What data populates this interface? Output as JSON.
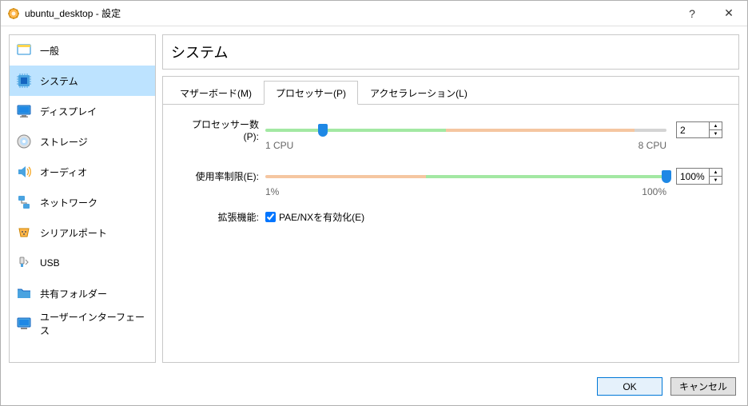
{
  "window": {
    "title": "ubuntu_desktop - 設定"
  },
  "sidebar": {
    "items": [
      {
        "label": "一般"
      },
      {
        "label": "システム"
      },
      {
        "label": "ディスプレイ"
      },
      {
        "label": "ストレージ"
      },
      {
        "label": "オーディオ"
      },
      {
        "label": "ネットワーク"
      },
      {
        "label": "シリアルポート"
      },
      {
        "label": "USB"
      },
      {
        "label": "共有フォルダー"
      },
      {
        "label": "ユーザーインターフェース"
      }
    ],
    "active_index": 1
  },
  "main": {
    "heading": "システム",
    "tabs": [
      {
        "label": "マザーボード(M)"
      },
      {
        "label": "プロセッサー(P)"
      },
      {
        "label": "アクセラレーション(L)"
      }
    ],
    "active_tab": 1,
    "processor": {
      "count_label": "プロセッサー数(P):",
      "count_value": "2",
      "count_min_label": "1 CPU",
      "count_max_label": "8 CPU",
      "cap_label": "使用率制限(E):",
      "cap_value": "100%",
      "cap_min_label": "1%",
      "cap_max_label": "100%",
      "ext_label": "拡張機能:",
      "pae_label": "PAE/NXを有効化(E)"
    }
  },
  "footer": {
    "ok": "OK",
    "cancel": "キャンセル"
  }
}
